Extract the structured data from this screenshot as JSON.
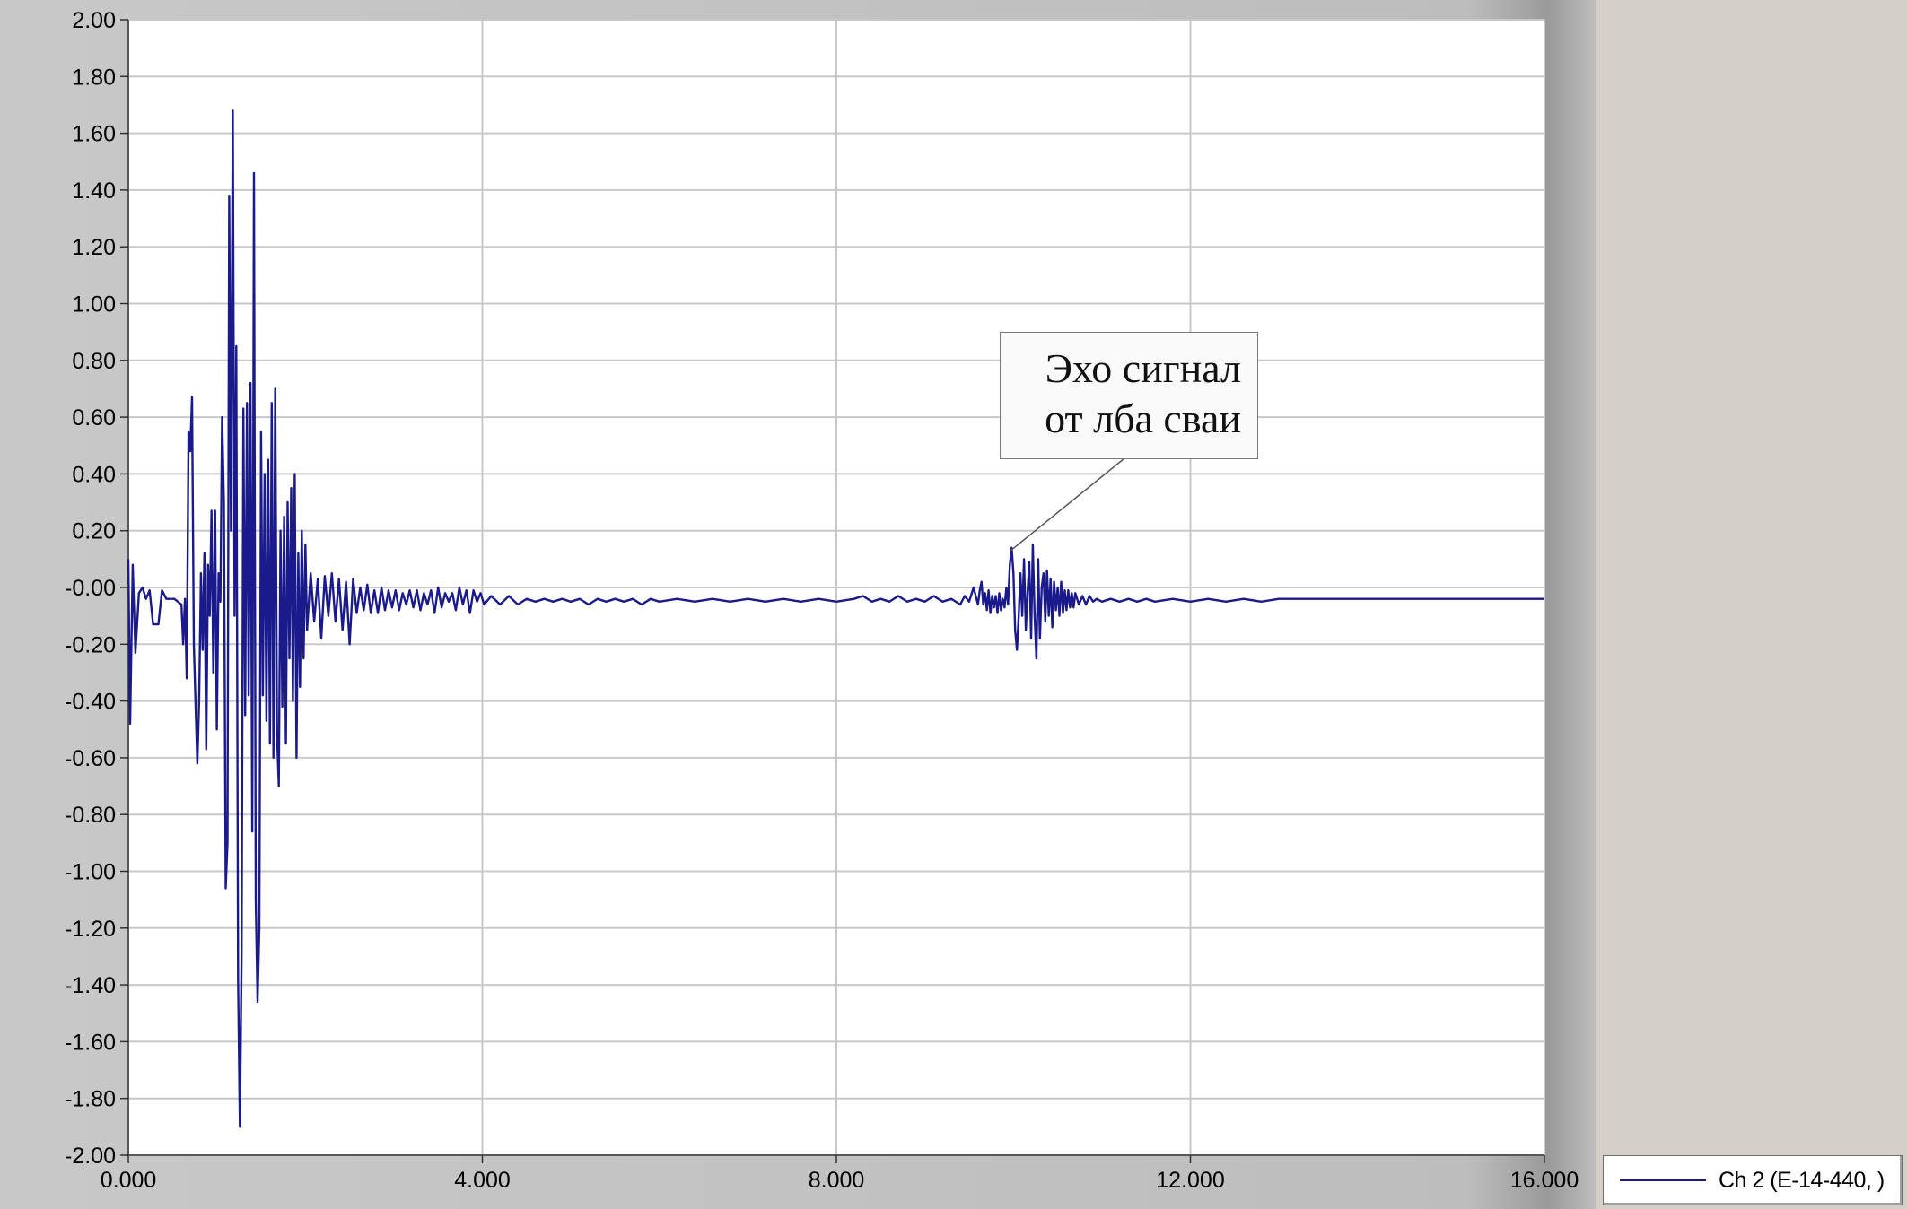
{
  "chart_data": {
    "type": "line",
    "xlim": [
      0,
      16
    ],
    "ylim": [
      -2,
      2
    ],
    "x_ticks": [
      "0.000",
      "4.000",
      "8.000",
      "12.000",
      "16.000"
    ],
    "y_ticks": [
      "2.00",
      "1.80",
      "1.60",
      "1.40",
      "1.20",
      "1.00",
      "0.80",
      "0.60",
      "0.40",
      "0.20",
      "-0.00",
      "-0.20",
      "-0.40",
      "-0.60",
      "-0.80",
      "-1.00",
      "-1.20",
      "-1.40",
      "-1.60",
      "-1.80",
      "-2.00"
    ],
    "grid": true,
    "series": [
      {
        "name": "Ch  2 (E-14-440, )",
        "color": "#1a1a8c",
        "points": [
          [
            0.0,
            0.1
          ],
          [
            0.02,
            -0.48
          ],
          [
            0.05,
            0.08
          ],
          [
            0.08,
            -0.23
          ],
          [
            0.12,
            -0.02
          ],
          [
            0.16,
            0.0
          ],
          [
            0.2,
            -0.04
          ],
          [
            0.24,
            -0.01
          ],
          [
            0.28,
            -0.13
          ],
          [
            0.34,
            -0.13
          ],
          [
            0.38,
            -0.01
          ],
          [
            0.43,
            -0.04
          ],
          [
            0.52,
            -0.04
          ],
          [
            0.56,
            -0.05
          ],
          [
            0.6,
            -0.06
          ],
          [
            0.62,
            -0.2
          ],
          [
            0.64,
            -0.04
          ],
          [
            0.66,
            -0.32
          ],
          [
            0.68,
            0.55
          ],
          [
            0.7,
            0.48
          ],
          [
            0.72,
            0.67
          ],
          [
            0.74,
            -0.2
          ],
          [
            0.76,
            -0.42
          ],
          [
            0.78,
            -0.62
          ],
          [
            0.8,
            -0.4
          ],
          [
            0.82,
            0.05
          ],
          [
            0.84,
            -0.22
          ],
          [
            0.86,
            0.12
          ],
          [
            0.88,
            -0.57
          ],
          [
            0.9,
            0.08
          ],
          [
            0.92,
            -0.1
          ],
          [
            0.94,
            0.27
          ],
          [
            0.96,
            -0.3
          ],
          [
            0.98,
            0.27
          ],
          [
            1.0,
            -0.5
          ],
          [
            1.02,
            0.05
          ],
          [
            1.04,
            -0.05
          ],
          [
            1.06,
            0.6
          ],
          [
            1.08,
            0.3
          ],
          [
            1.1,
            -1.06
          ],
          [
            1.12,
            -0.9
          ],
          [
            1.14,
            1.38
          ],
          [
            1.16,
            0.2
          ],
          [
            1.18,
            1.68
          ],
          [
            1.2,
            -0.1
          ],
          [
            1.22,
            0.85
          ],
          [
            1.24,
            -1.38
          ],
          [
            1.26,
            -1.9
          ],
          [
            1.28,
            -1.3
          ],
          [
            1.3,
            0.63
          ],
          [
            1.32,
            -0.45
          ],
          [
            1.34,
            0.65
          ],
          [
            1.36,
            -0.38
          ],
          [
            1.38,
            0.72
          ],
          [
            1.4,
            -0.86
          ],
          [
            1.42,
            1.46
          ],
          [
            1.44,
            -1.1
          ],
          [
            1.46,
            -1.46
          ],
          [
            1.48,
            -1.2
          ],
          [
            1.5,
            0.55
          ],
          [
            1.52,
            -0.38
          ],
          [
            1.54,
            0.4
          ],
          [
            1.56,
            -0.47
          ],
          [
            1.58,
            0.45
          ],
          [
            1.6,
            -0.55
          ],
          [
            1.62,
            0.65
          ],
          [
            1.64,
            -0.6
          ],
          [
            1.66,
            0.7
          ],
          [
            1.68,
            -0.52
          ],
          [
            1.7,
            -0.7
          ],
          [
            1.72,
            0.2
          ],
          [
            1.74,
            -0.42
          ],
          [
            1.76,
            0.25
          ],
          [
            1.78,
            -0.55
          ],
          [
            1.8,
            0.3
          ],
          [
            1.82,
            -0.25
          ],
          [
            1.84,
            0.35
          ],
          [
            1.86,
            -0.4
          ],
          [
            1.88,
            0.4
          ],
          [
            1.9,
            -0.6
          ],
          [
            1.92,
            0.12
          ],
          [
            1.94,
            -0.35
          ],
          [
            1.96,
            0.2
          ],
          [
            1.98,
            -0.25
          ],
          [
            2.0,
            0.15
          ],
          [
            2.02,
            -0.15
          ],
          [
            2.06,
            0.05
          ],
          [
            2.1,
            -0.12
          ],
          [
            2.14,
            0.03
          ],
          [
            2.18,
            -0.18
          ],
          [
            2.22,
            0.04
          ],
          [
            2.26,
            -0.1
          ],
          [
            2.3,
            0.05
          ],
          [
            2.34,
            -0.12
          ],
          [
            2.38,
            0.03
          ],
          [
            2.42,
            -0.15
          ],
          [
            2.46,
            0.02
          ],
          [
            2.5,
            -0.2
          ],
          [
            2.54,
            0.03
          ],
          [
            2.58,
            -0.09
          ],
          [
            2.62,
            0.0
          ],
          [
            2.66,
            -0.08
          ],
          [
            2.7,
            0.01
          ],
          [
            2.74,
            -0.09
          ],
          [
            2.78,
            -0.01
          ],
          [
            2.82,
            -0.09
          ],
          [
            2.86,
            0.0
          ],
          [
            2.9,
            -0.08
          ],
          [
            2.94,
            -0.01
          ],
          [
            2.98,
            -0.07
          ],
          [
            3.02,
            -0.01
          ],
          [
            3.06,
            -0.08
          ],
          [
            3.1,
            -0.02
          ],
          [
            3.14,
            -0.06
          ],
          [
            3.18,
            -0.01
          ],
          [
            3.22,
            -0.07
          ],
          [
            3.26,
            -0.01
          ],
          [
            3.3,
            -0.08
          ],
          [
            3.34,
            -0.02
          ],
          [
            3.38,
            -0.06
          ],
          [
            3.42,
            -0.01
          ],
          [
            3.46,
            -0.09
          ],
          [
            3.5,
            0.0
          ],
          [
            3.54,
            -0.07
          ],
          [
            3.58,
            -0.02
          ],
          [
            3.62,
            -0.05
          ],
          [
            3.66,
            -0.02
          ],
          [
            3.7,
            -0.08
          ],
          [
            3.74,
            0.0
          ],
          [
            3.78,
            -0.06
          ],
          [
            3.82,
            -0.01
          ],
          [
            3.86,
            -0.09
          ],
          [
            3.9,
            -0.01
          ],
          [
            3.94,
            -0.05
          ],
          [
            3.98,
            -0.02
          ],
          [
            4.02,
            -0.06
          ],
          [
            4.1,
            -0.03
          ],
          [
            4.2,
            -0.06
          ],
          [
            4.3,
            -0.03
          ],
          [
            4.4,
            -0.06
          ],
          [
            4.5,
            -0.04
          ],
          [
            4.6,
            -0.05
          ],
          [
            4.7,
            -0.04
          ],
          [
            4.8,
            -0.05
          ],
          [
            4.9,
            -0.04
          ],
          [
            5.0,
            -0.05
          ],
          [
            5.1,
            -0.04
          ],
          [
            5.2,
            -0.06
          ],
          [
            5.3,
            -0.04
          ],
          [
            5.4,
            -0.05
          ],
          [
            5.5,
            -0.04
          ],
          [
            5.6,
            -0.05
          ],
          [
            5.7,
            -0.04
          ],
          [
            5.8,
            -0.06
          ],
          [
            5.9,
            -0.04
          ],
          [
            6.0,
            -0.05
          ],
          [
            6.2,
            -0.04
          ],
          [
            6.4,
            -0.05
          ],
          [
            6.6,
            -0.04
          ],
          [
            6.8,
            -0.05
          ],
          [
            7.0,
            -0.04
          ],
          [
            7.2,
            -0.05
          ],
          [
            7.4,
            -0.04
          ],
          [
            7.6,
            -0.05
          ],
          [
            7.8,
            -0.04
          ],
          [
            8.0,
            -0.05
          ],
          [
            8.2,
            -0.04
          ],
          [
            8.3,
            -0.03
          ],
          [
            8.4,
            -0.05
          ],
          [
            8.5,
            -0.04
          ],
          [
            8.6,
            -0.05
          ],
          [
            8.7,
            -0.03
          ],
          [
            8.8,
            -0.05
          ],
          [
            8.9,
            -0.04
          ],
          [
            9.0,
            -0.05
          ],
          [
            9.1,
            -0.03
          ],
          [
            9.2,
            -0.05
          ],
          [
            9.3,
            -0.04
          ],
          [
            9.4,
            -0.06
          ],
          [
            9.45,
            -0.03
          ],
          [
            9.5,
            -0.05
          ],
          [
            9.55,
            0.0
          ],
          [
            9.6,
            -0.06
          ],
          [
            9.62,
            -0.01
          ],
          [
            9.64,
            0.02
          ],
          [
            9.66,
            -0.06
          ],
          [
            9.68,
            -0.02
          ],
          [
            9.7,
            -0.08
          ],
          [
            9.72,
            -0.01
          ],
          [
            9.74,
            -0.09
          ],
          [
            9.76,
            -0.03
          ],
          [
            9.78,
            -0.07
          ],
          [
            9.8,
            -0.03
          ],
          [
            9.82,
            -0.09
          ],
          [
            9.84,
            -0.02
          ],
          [
            9.86,
            -0.08
          ],
          [
            9.88,
            -0.04
          ],
          [
            9.9,
            -0.07
          ],
          [
            9.92,
            0.0
          ],
          [
            9.94,
            -0.06
          ],
          [
            9.96,
            0.08
          ],
          [
            9.98,
            0.14
          ],
          [
            10.0,
            0.05
          ],
          [
            10.02,
            -0.15
          ],
          [
            10.04,
            -0.22
          ],
          [
            10.06,
            -0.1
          ],
          [
            10.08,
            0.05
          ],
          [
            10.1,
            -0.1
          ],
          [
            10.12,
            0.1
          ],
          [
            10.14,
            -0.15
          ],
          [
            10.16,
            -0.02
          ],
          [
            10.18,
            0.09
          ],
          [
            10.2,
            -0.18
          ],
          [
            10.22,
            0.15
          ],
          [
            10.24,
            -0.1
          ],
          [
            10.26,
            -0.25
          ],
          [
            10.28,
            0.1
          ],
          [
            10.3,
            -0.18
          ],
          [
            10.32,
            0.0
          ],
          [
            10.34,
            0.05
          ],
          [
            10.36,
            -0.12
          ],
          [
            10.38,
            0.06
          ],
          [
            10.4,
            -0.1
          ],
          [
            10.42,
            0.03
          ],
          [
            10.44,
            -0.14
          ],
          [
            10.46,
            0.02
          ],
          [
            10.48,
            -0.08
          ],
          [
            10.5,
            0.0
          ],
          [
            10.52,
            -0.1
          ],
          [
            10.54,
            0.02
          ],
          [
            10.56,
            -0.09
          ],
          [
            10.58,
            -0.01
          ],
          [
            10.6,
            -0.08
          ],
          [
            10.62,
            -0.01
          ],
          [
            10.64,
            -0.07
          ],
          [
            10.66,
            -0.02
          ],
          [
            10.68,
            -0.07
          ],
          [
            10.7,
            -0.02
          ],
          [
            10.74,
            -0.06
          ],
          [
            10.78,
            -0.03
          ],
          [
            10.82,
            -0.06
          ],
          [
            10.86,
            -0.03
          ],
          [
            10.9,
            -0.05
          ],
          [
            10.94,
            -0.04
          ],
          [
            11.0,
            -0.05
          ],
          [
            11.1,
            -0.04
          ],
          [
            11.2,
            -0.05
          ],
          [
            11.3,
            -0.04
          ],
          [
            11.4,
            -0.05
          ],
          [
            11.5,
            -0.04
          ],
          [
            11.6,
            -0.05
          ],
          [
            11.8,
            -0.04
          ],
          [
            12.0,
            -0.05
          ],
          [
            12.2,
            -0.04
          ],
          [
            12.4,
            -0.05
          ],
          [
            12.6,
            -0.04
          ],
          [
            12.8,
            -0.05
          ],
          [
            13.0,
            -0.04
          ],
          [
            13.5,
            -0.04
          ],
          [
            14.0,
            -0.04
          ],
          [
            15.0,
            -0.04
          ],
          [
            16.0,
            -0.04
          ]
        ]
      }
    ],
    "annotations": [
      {
        "lines": [
          "Эхо сигнал",
          "от лба сваи"
        ],
        "target": [
          9.97,
          0.13
        ]
      }
    ],
    "legend": {
      "placement": "bottom-right",
      "label": "Ch  2 (E-14-440, )"
    }
  }
}
